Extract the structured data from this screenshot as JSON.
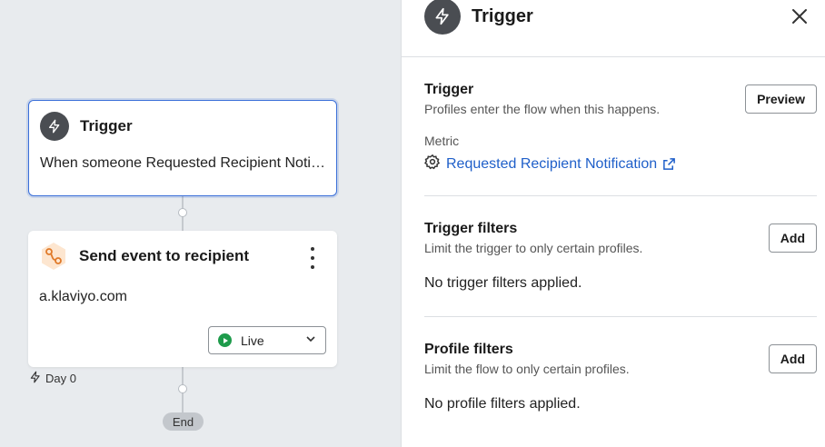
{
  "flow": {
    "trigger_node": {
      "title": "Trigger",
      "description": "When someone Requested Recipient Notification"
    },
    "action_node": {
      "title": "Send event to recipient",
      "description": "a.klaviyo.com",
      "status": "Live"
    },
    "delay_label": "Day 0",
    "end_label": "End"
  },
  "panel": {
    "title": "Trigger",
    "trigger_section": {
      "title": "Trigger",
      "subtitle": "Profiles enter the flow when this happens.",
      "button_label": "Preview",
      "metric_label": "Metric",
      "metric_value": "Requested Recipient Notification"
    },
    "trigger_filters": {
      "title": "Trigger filters",
      "subtitle": "Limit the trigger to only certain profiles.",
      "button_label": "Add",
      "empty_text": "No trigger filters applied."
    },
    "profile_filters": {
      "title": "Profile filters",
      "subtitle": "Limit the flow to only certain profiles.",
      "button_label": "Add",
      "empty_text": "No profile filters applied."
    }
  },
  "colors": {
    "accent": "#3a6fd8",
    "link": "#1f5fc9",
    "live": "#1e9b4b",
    "icon_dark": "#4a4d52",
    "webhook_orange": "#e07a2a"
  },
  "icons": {
    "trigger": "lightning-bolt-icon",
    "action": "webhook-hexagon-icon",
    "menu": "kebab-menu-icon",
    "status": "play-circle-icon",
    "dropdown": "chevron-down-icon",
    "close": "close-icon",
    "metric": "gear-icon",
    "external": "external-link-icon"
  }
}
